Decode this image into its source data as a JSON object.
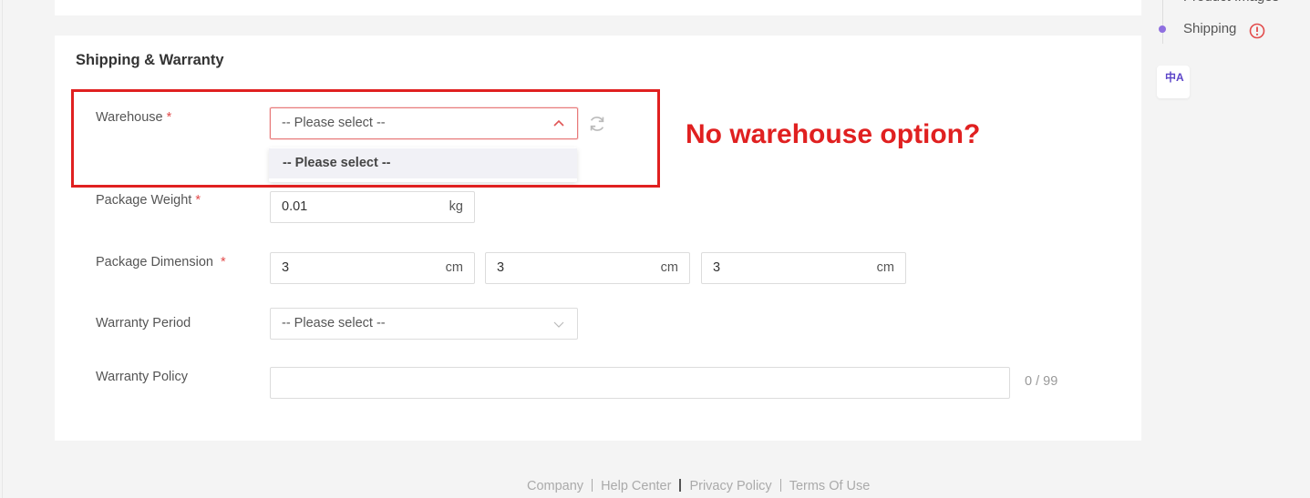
{
  "section_title": "Shipping & Warranty",
  "required_mark": "*",
  "warehouse": {
    "label": "Warehouse",
    "placeholder": "-- Please select --",
    "dropdown_option": "-- Please select --",
    "refresh_icon": "refresh-icon",
    "chevron_icon": "chevron-up-icon"
  },
  "package_weight": {
    "label": "Package Weight",
    "value": "0.01",
    "unit": "kg"
  },
  "package_dimension": {
    "label": "Package Dimension",
    "fields": [
      {
        "value": "3",
        "unit": "cm"
      },
      {
        "value": "3",
        "unit": "cm"
      },
      {
        "value": "3",
        "unit": "cm"
      }
    ]
  },
  "warranty_period": {
    "label": "Warranty Period",
    "placeholder": "-- Please select --",
    "chevron_icon": "chevron-down-icon"
  },
  "warranty_policy": {
    "label": "Warranty Policy",
    "value": "",
    "counter": "0 / 99"
  },
  "annotation": {
    "text": "No warehouse option?",
    "color": "#e02020"
  },
  "side_nav": {
    "prev_item": "Product Images",
    "current_item": "Shipping",
    "warning_icon": "warning-icon",
    "accent": "#8f6fe0",
    "translate_label": "中A"
  },
  "footer": {
    "links": [
      "Company",
      "Help Center",
      "Privacy Policy",
      "Terms Of Use"
    ]
  }
}
